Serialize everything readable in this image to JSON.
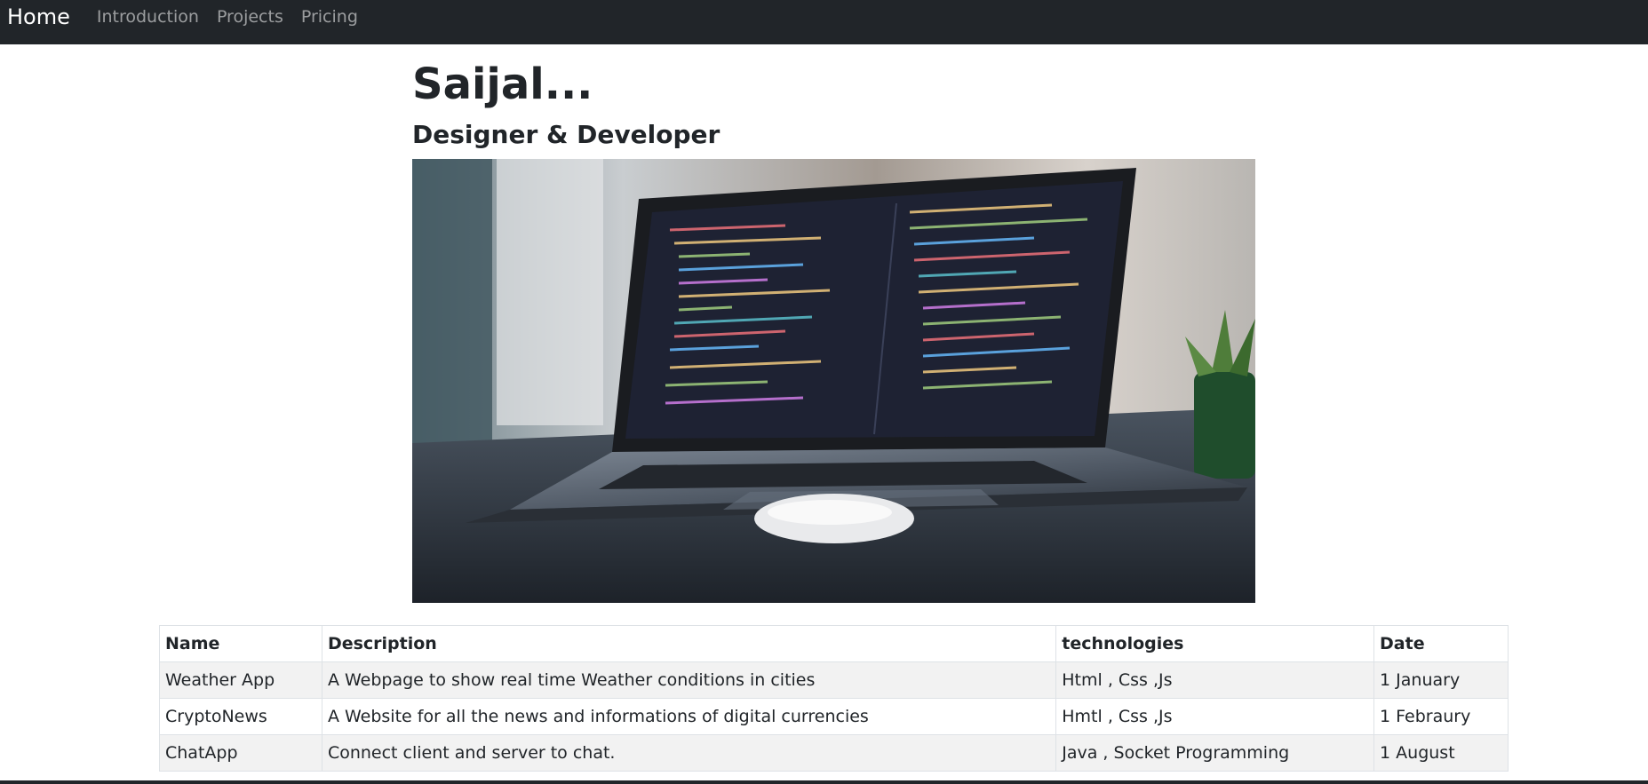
{
  "navbar": {
    "brand": "Home",
    "links": [
      {
        "label": "Introduction"
      },
      {
        "label": "Projects"
      },
      {
        "label": "Pricing"
      }
    ]
  },
  "hero": {
    "title": "Saijal...",
    "subtitle": "Designer & Developer"
  },
  "projects_table": {
    "headers": [
      "Name",
      "Description",
      "technologies",
      "Date"
    ],
    "rows": [
      {
        "name": "Weather App",
        "description": "A Webpage to show real time Weather conditions in cities",
        "technologies": "Html , Css ,Js",
        "date": "1 January"
      },
      {
        "name": "CryptoNews",
        "description": "A Website for all the news and informations of digital currencies",
        "technologies": "Hmtl , Css ,Js",
        "date": "1 Febraury"
      },
      {
        "name": "ChatApp",
        "description": "Connect client and server to chat.",
        "technologies": "Java , Socket Programming",
        "date": "1 August"
      }
    ]
  },
  "colors": {
    "navbar_bg": "#212529",
    "table_stripe": "#f2f2f2",
    "text": "#212529"
  }
}
